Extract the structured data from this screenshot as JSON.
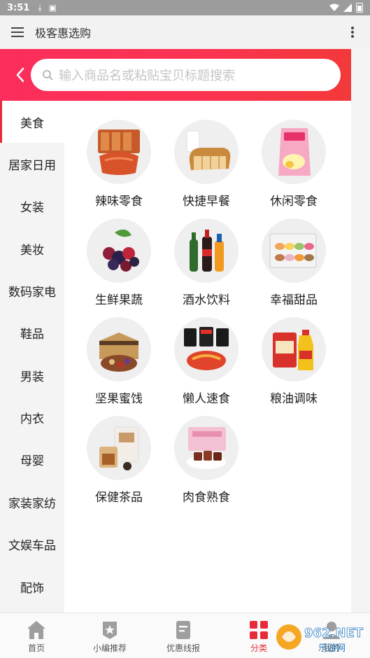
{
  "status_bar": {
    "time": "3:51"
  },
  "app_bar": {
    "title": "极客惠选购"
  },
  "search": {
    "placeholder": "输入商品名或粘贴宝贝标题搜索"
  },
  "sidebar": {
    "items": [
      {
        "label": "美食",
        "active": true
      },
      {
        "label": "居家日用",
        "active": false
      },
      {
        "label": "女装",
        "active": false
      },
      {
        "label": "美妆",
        "active": false
      },
      {
        "label": "数码家电",
        "active": false
      },
      {
        "label": "鞋品",
        "active": false
      },
      {
        "label": "男装",
        "active": false
      },
      {
        "label": "内衣",
        "active": false
      },
      {
        "label": "母婴",
        "active": false
      },
      {
        "label": "家装家纺",
        "active": false
      },
      {
        "label": "文娱车品",
        "active": false
      },
      {
        "label": "配饰",
        "active": false
      }
    ]
  },
  "categories": [
    {
      "label": "辣味零食",
      "icon": "spicy-snack-icon"
    },
    {
      "label": "快捷早餐",
      "icon": "bread-milk-icon"
    },
    {
      "label": "休闲零食",
      "icon": "chips-bag-icon"
    },
    {
      "label": "生鲜果蔬",
      "icon": "berries-icon"
    },
    {
      "label": "酒水饮料",
      "icon": "bottles-icon"
    },
    {
      "label": "幸福甜品",
      "icon": "macaron-box-icon"
    },
    {
      "label": "坚果蜜饯",
      "icon": "nuts-box-icon"
    },
    {
      "label": "懒人速食",
      "icon": "instant-noodles-icon"
    },
    {
      "label": "粮油调味",
      "icon": "rice-oil-icon"
    },
    {
      "label": "保健茶品",
      "icon": "tea-icon"
    },
    {
      "label": "肉食熟食",
      "icon": "beef-jerky-icon"
    }
  ],
  "tab_bar": {
    "tabs": [
      {
        "label": "首页",
        "icon": "home-icon",
        "active": false
      },
      {
        "label": "小编推荐",
        "icon": "badge-star-icon",
        "active": false
      },
      {
        "label": "优惠线报",
        "icon": "document-icon",
        "active": false
      },
      {
        "label": "分类",
        "icon": "grid-icon",
        "active": true
      },
      {
        "label": "我的",
        "icon": "user-icon",
        "active": false
      }
    ]
  },
  "watermark": {
    "brand": "962.NET",
    "sub": "乐游网"
  },
  "colors": {
    "accent": "#e82b3a",
    "search_gradient_start": "#fb2e5c",
    "search_gradient_end": "#f2393a"
  }
}
